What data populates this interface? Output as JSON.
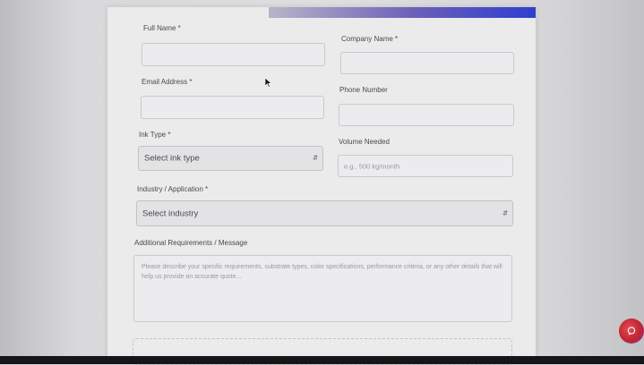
{
  "form": {
    "full_name": {
      "label": "Full Name *",
      "value": ""
    },
    "company_name": {
      "label": "Company Name *",
      "value": ""
    },
    "email": {
      "label": "Email Address *",
      "value": ""
    },
    "phone": {
      "label": "Phone Number",
      "value": ""
    },
    "ink_type": {
      "label": "Ink Type *",
      "selected": "Select ink type"
    },
    "volume": {
      "label": "Volume Needed",
      "placeholder": "e.g., 500 kg/month"
    },
    "industry": {
      "label": "Industry / Application *",
      "selected": "Select industry"
    },
    "message": {
      "label": "Additional Requirements / Message",
      "placeholder": "Please describe your specific requirements, substrate types, color specifications, performance criteria, or any other details that will help us provide an accurate quote..."
    }
  },
  "icons": {
    "select_caret": "updown-chevron-icon",
    "chat": "chat-bubble-icon",
    "cursor": "mouse-pointer-icon"
  },
  "colors": {
    "accent_start": "#6a5fb8",
    "accent_end": "#2f3fcf",
    "chat_button": "#c0262f"
  }
}
